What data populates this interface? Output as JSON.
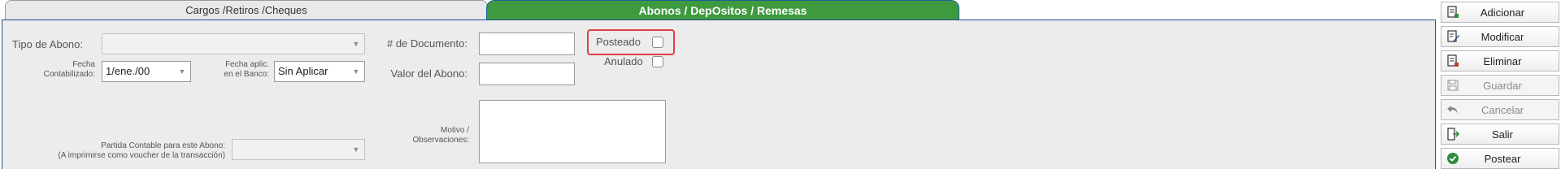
{
  "tabs": {
    "inactive_label": "Cargos /Retiros /Cheques",
    "active_label": "Abonos / DepOsitos / Remesas"
  },
  "form": {
    "tipo_abono_label": "Tipo de Abono:",
    "tipo_abono_value": "",
    "fecha_contab_label_l1": "Fecha",
    "fecha_contab_label_l2": "Contabilizado:",
    "fecha_contab_value": "1/ene./00",
    "fecha_banco_label_l1": "Fecha aplic.",
    "fecha_banco_label_l2": "en el Banco:",
    "fecha_banco_value": "Sin Aplicar",
    "num_doc_label": "# de Documento:",
    "num_doc_value": "",
    "valor_abono_label": "Valor del Abono:",
    "valor_abono_value": "",
    "posteado_label": "Posteado",
    "posteado_checked": false,
    "anulado_label": "Anulado",
    "anulado_checked": false,
    "partida_label_l1": "Partida Contable para este Abono:",
    "partida_label_l2": "(A imprimirse como voucher de la transacción)",
    "partida_value": "",
    "motivo_label_l1": "Motivo /",
    "motivo_label_l2": "Observaciones:",
    "motivo_value": ""
  },
  "actions": {
    "adicionar": "Adicionar",
    "modificar": "Modificar",
    "eliminar": "Eliminar",
    "guardar": "Guardar",
    "cancelar": "Cancelar",
    "salir": "Salir",
    "postear": "Postear"
  },
  "colors": {
    "active_tab": "#3e9a3e",
    "panel_border": "#1f4f8c",
    "highlight": "#e04040",
    "post_icon": "#2e8b3e"
  }
}
